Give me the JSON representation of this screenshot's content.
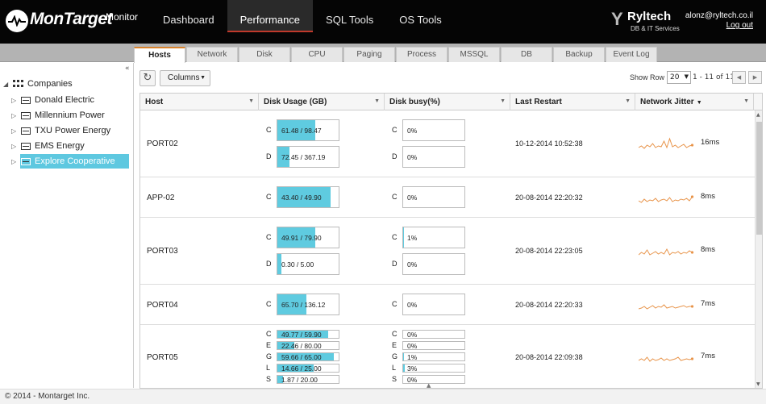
{
  "app": {
    "logo_text": "MonTarget",
    "subtitle": "Monitor"
  },
  "nav": {
    "items": [
      "Dashboard",
      "Performance",
      "SQL Tools",
      "OS Tools"
    ],
    "active": "Performance"
  },
  "brand": {
    "y": "Y",
    "name": "Ryltech",
    "tagline": "DB & IT Services"
  },
  "user": {
    "email": "alonz@ryltech.co.il",
    "logout": "Log out"
  },
  "tabs": {
    "items": [
      "Hosts",
      "Network",
      "Disk",
      "CPU",
      "Paging",
      "Process",
      "MSSQL",
      "DB",
      "Backup",
      "Event Log"
    ],
    "active": "Hosts"
  },
  "sidebar": {
    "collapse": "«",
    "root": "Companies",
    "items": [
      "Donald Electric",
      "Millennium Power",
      "TXU Power Energy",
      "EMS Energy",
      "Explore Cooperative"
    ],
    "selected": "Explore Cooperative"
  },
  "toolbar": {
    "columns": "Columns",
    "show_row_label": "Show Row",
    "show_row_value": "20",
    "range": "1 - 11 of 11"
  },
  "grid": {
    "headers": [
      "Host",
      "Disk Usage (GB)",
      "Disk busy(%)",
      "Last Restart",
      "Network Jitter"
    ],
    "rows": [
      {
        "host": "PORT02",
        "restart": "10-12-2014 10:52:38",
        "jitter": "16ms",
        "usage": [
          {
            "d": "C",
            "t": "61.48 / 98.47",
            "p": 0.62
          },
          {
            "d": "D",
            "t": "72.45 / 367.19",
            "p": 0.2
          }
        ],
        "busy": [
          {
            "d": "C",
            "t": "0%",
            "p": 0
          },
          {
            "d": "D",
            "t": "0%",
            "p": 0
          }
        ]
      },
      {
        "host": "APP-02",
        "restart": "20-08-2014 22:20:32",
        "jitter": "8ms",
        "usage": [
          {
            "d": "C",
            "t": "43.40 / 49.90",
            "p": 0.87
          }
        ],
        "busy": [
          {
            "d": "C",
            "t": "0%",
            "p": 0
          }
        ]
      },
      {
        "host": "PORT03",
        "restart": "20-08-2014 22:23:05",
        "jitter": "8ms",
        "usage": [
          {
            "d": "C",
            "t": "49.91 / 79.90",
            "p": 0.62
          },
          {
            "d": "D",
            "t": "0.30 / 5.00",
            "p": 0.06
          }
        ],
        "busy": [
          {
            "d": "C",
            "t": "1%",
            "p": 0.01
          },
          {
            "d": "D",
            "t": "0%",
            "p": 0
          }
        ]
      },
      {
        "host": "PORT04",
        "restart": "20-08-2014 22:20:33",
        "jitter": "7ms",
        "usage": [
          {
            "d": "C",
            "t": "65.70 / 136.12",
            "p": 0.48
          }
        ],
        "busy": [
          {
            "d": "C",
            "t": "0%",
            "p": 0
          }
        ]
      },
      {
        "host": "PORT05",
        "restart": "20-08-2014 22:09:38",
        "jitter": "7ms",
        "usage": [
          {
            "d": "C",
            "t": "49.77 / 59.90",
            "p": 0.83
          },
          {
            "d": "E",
            "t": "22.46 / 80.00",
            "p": 0.28
          },
          {
            "d": "G",
            "t": "59.66 / 65.00",
            "p": 0.92
          },
          {
            "d": "L",
            "t": "14.66 / 25.00",
            "p": 0.59
          },
          {
            "d": "S",
            "t": "1.87 / 20.00",
            "p": 0.09
          }
        ],
        "busy": [
          {
            "d": "C",
            "t": "0%",
            "p": 0
          },
          {
            "d": "E",
            "t": "0%",
            "p": 0
          },
          {
            "d": "G",
            "t": "1%",
            "p": 0.01
          },
          {
            "d": "L",
            "t": "3%",
            "p": 0.03
          },
          {
            "d": "S",
            "t": "0%",
            "p": 0
          }
        ]
      }
    ]
  },
  "footer": {
    "text": "© 2014 - Montarget Inc."
  },
  "colors": {
    "accent_tab": "#d9822b",
    "bar_fill": "#5fcbe0",
    "spark": "#e8944a",
    "nav_active": "#c0392b"
  }
}
